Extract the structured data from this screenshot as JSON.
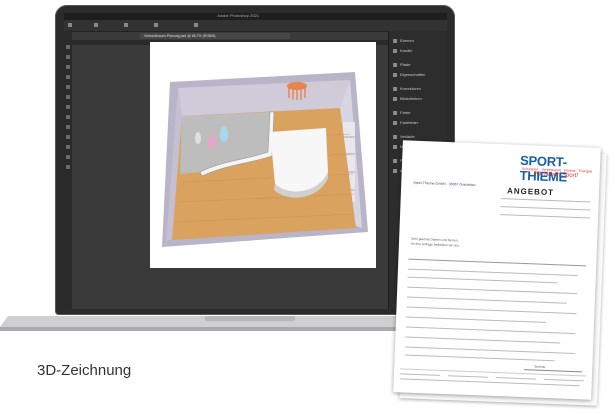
{
  "caption": "3D-Zeichnung",
  "photoshop": {
    "window_title": "Adobe Photoshop 2021",
    "document_tab": "Verkaufsraum-Planung.psd @ 66,7% (RGB/8)",
    "panels": [
      "Ebenen",
      "Kanäle",
      "Pfade",
      "Eigenschaften",
      "Korrekturen",
      "Bibliotheken",
      "Farbe",
      "Farbfelder",
      "Verläufe",
      "Muster",
      "Protokoll",
      "Aktionen"
    ]
  },
  "document": {
    "logo": "SPORT-THIEME",
    "tagline": "Schulsport · Vereinssport · Fitness · Therapie",
    "script_line": "Wir lieben Sport!",
    "address_line": "Sport-Thieme GmbH · 38367 Grasleben",
    "title": "ANGEBOT",
    "greeting": "Sehr geehrte Damen und Herren,",
    "intro": "für Ihre Anfrage bedanken wir uns.",
    "total_label": "Summe"
  },
  "colors": {
    "brand_blue": "#1a5ea8",
    "brand_red": "#cc3333",
    "floor_wood": "#d9a35f"
  }
}
